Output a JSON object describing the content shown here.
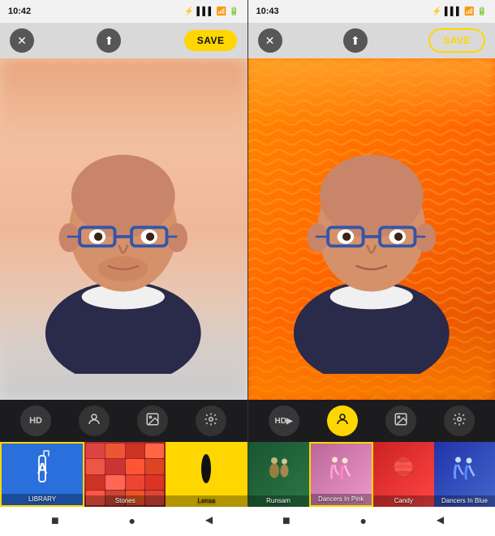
{
  "left_panel": {
    "status_bar": {
      "time": "10:42",
      "icons": "bluetooth signal wifi battery"
    },
    "toolbar": {
      "close_label": "✕",
      "share_label": "⬆",
      "save_label": "SAVE"
    },
    "icon_row": {
      "hd_label": "HD",
      "face_label": "👤",
      "gallery_label": "🖼",
      "settings_label": "⚙"
    },
    "filters": [
      {
        "id": "library",
        "label": "LIBRARY"
      },
      {
        "id": "stones",
        "label": "Stones"
      },
      {
        "id": "lensa",
        "label": "Lensa"
      }
    ]
  },
  "right_panel": {
    "status_bar": {
      "time": "10:43",
      "icons": "bluetooth signal wifi battery"
    },
    "toolbar": {
      "close_label": "✕",
      "share_label": "⬆",
      "save_label": "SAVE"
    },
    "icon_row": {
      "hd_label": "HD▶",
      "face_label": "👤",
      "gallery_label": "🖼",
      "settings_label": "⚙"
    },
    "filters": [
      {
        "id": "runsam",
        "label": "Runsam"
      },
      {
        "id": "dancers-pink",
        "label": "Dancers In Pink"
      },
      {
        "id": "candy",
        "label": "Candy"
      },
      {
        "id": "dancers-blue",
        "label": "Dancers In Blue"
      }
    ]
  },
  "nav_bar": {
    "left_square": "■",
    "center_circle": "●",
    "right_triangle": "◀"
  },
  "colors": {
    "save_yellow": "#FFD600",
    "active_yellow": "#FFD600",
    "library_blue": "#2a6fdb"
  }
}
